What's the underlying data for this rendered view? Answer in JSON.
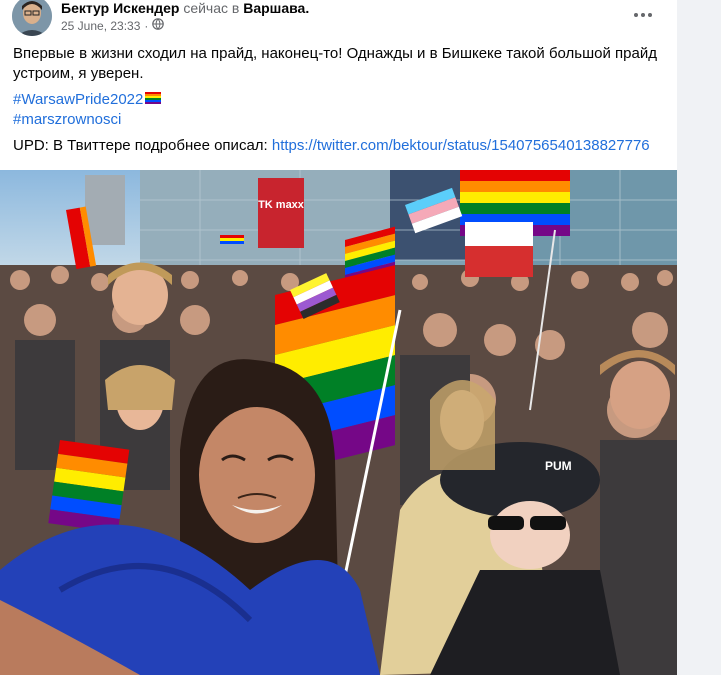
{
  "post": {
    "author_name": "Бектур Искендер",
    "status_text": "сейчас в",
    "location": "Варшава.",
    "date": "25 June, 23:33",
    "visibility_icon": "globe-icon",
    "more_icon": "more-options-icon",
    "text_line": "Впервые в жизни сходил на прайд, наконец-то! Однажды и в Бишкеке такой большой прайд устроим, я уверен.",
    "hashtag_1": "#WarsawPride2022",
    "hashtag_1_emoji": "rainbow-flag-emoji",
    "hashtag_2": "#marszrownosci",
    "upd_prefix": "UPD: В Твиттере подробнее описал: ",
    "upd_link": "https://twitter.com/bektour/status/1540756540138827776",
    "photo_alt_icon": "pride-parade-selfie-photo"
  },
  "photo_signs": {
    "store_sign": "TK maxx",
    "cap_text": "PUM"
  },
  "colors": {
    "link": "#216fdb",
    "secondary_text": "#65676b",
    "page_bg": "#f0f2f5"
  }
}
